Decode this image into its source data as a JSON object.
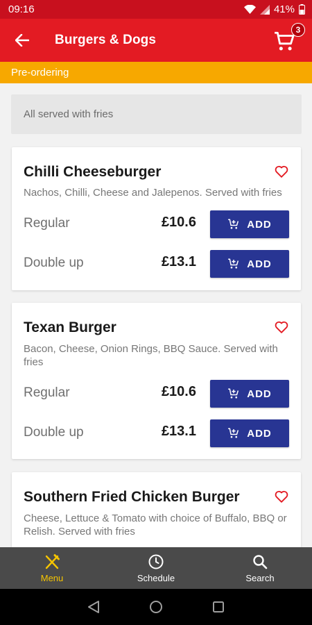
{
  "status": {
    "time": "09:16",
    "battery": "41%"
  },
  "appbar": {
    "title": "Burgers & Dogs",
    "cart_count": "3"
  },
  "banner": {
    "text": "Pre-ordering"
  },
  "note": "All served with fries",
  "items": [
    {
      "name": "Chilli Cheeseburger",
      "description": "Nachos, Chilli, Cheese and Jalepenos. Served with fries",
      "options": [
        {
          "label": "Regular",
          "price": "£10.6",
          "button": "ADD"
        },
        {
          "label": "Double up",
          "price": "£13.1",
          "button": "ADD"
        }
      ]
    },
    {
      "name": "Texan Burger",
      "description": "Bacon, Cheese, Onion Rings, BBQ Sauce. Served with fries",
      "options": [
        {
          "label": "Regular",
          "price": "£10.6",
          "button": "ADD"
        },
        {
          "label": "Double up",
          "price": "£13.1",
          "button": "ADD"
        }
      ]
    },
    {
      "name": "Southern Fried Chicken Burger",
      "description": "Cheese, Lettuce & Tomato with choice of Buffalo, BBQ or Relish. Served with fries"
    }
  ],
  "bottom_nav": [
    {
      "label": "Menu",
      "icon": "cutlery-icon",
      "active": true
    },
    {
      "label": "Schedule",
      "icon": "clock-icon"
    },
    {
      "label": "Search",
      "icon": "search-icon"
    }
  ],
  "colors": {
    "appbar": "#e31b23",
    "statusbar": "#c8101e",
    "banner": "#f7a800",
    "button": "#283593",
    "active_nav": "#f5c400"
  }
}
